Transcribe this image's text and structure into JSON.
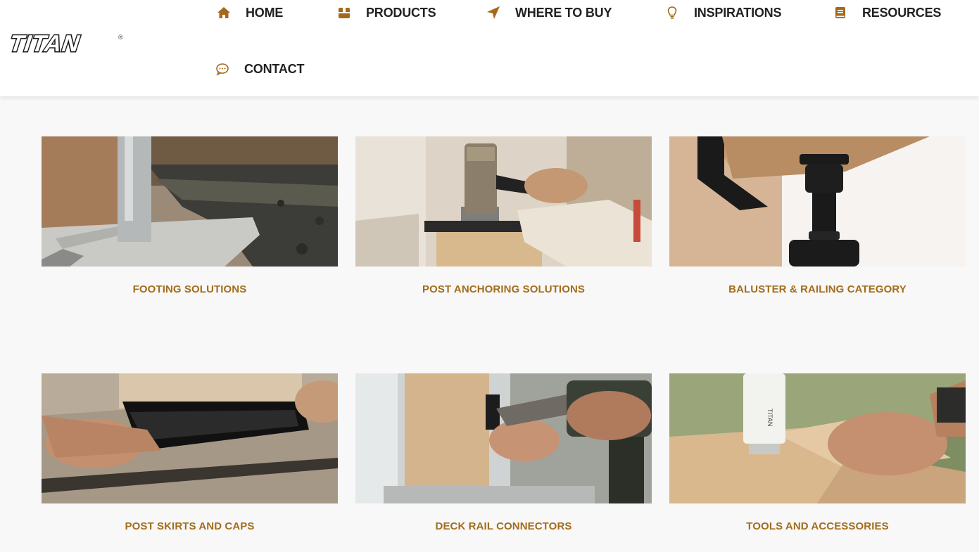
{
  "brand": {
    "logo_text": "TITAN",
    "registered_mark": "®"
  },
  "colors": {
    "accent": "#a36c1b",
    "nav_icon": "#a5691c",
    "nav_text": "#222222",
    "background": "#f8f8f8"
  },
  "nav": {
    "items": [
      {
        "label": "HOME",
        "icon": "home-icon"
      },
      {
        "label": "PRODUCTS",
        "icon": "box-icon"
      },
      {
        "label": "WHERE TO BUY",
        "icon": "location-arrow-icon"
      },
      {
        "label": "INSPIRATIONS",
        "icon": "lightbulb-icon"
      },
      {
        "label": "RESOURCES",
        "icon": "book-icon"
      },
      {
        "label": "CONTACT",
        "icon": "chat-bubble-icon"
      }
    ]
  },
  "categories": [
    {
      "label": "FOOTING SOLUTIONS"
    },
    {
      "label": "POST ANCHORING SOLUTIONS"
    },
    {
      "label": "BALUSTER & RAILING CATEGORY"
    },
    {
      "label": "POST SKIRTS AND CAPS"
    },
    {
      "label": "DECK RAIL CONNECTORS"
    },
    {
      "label": "TOOLS AND ACCESSORIES"
    }
  ]
}
